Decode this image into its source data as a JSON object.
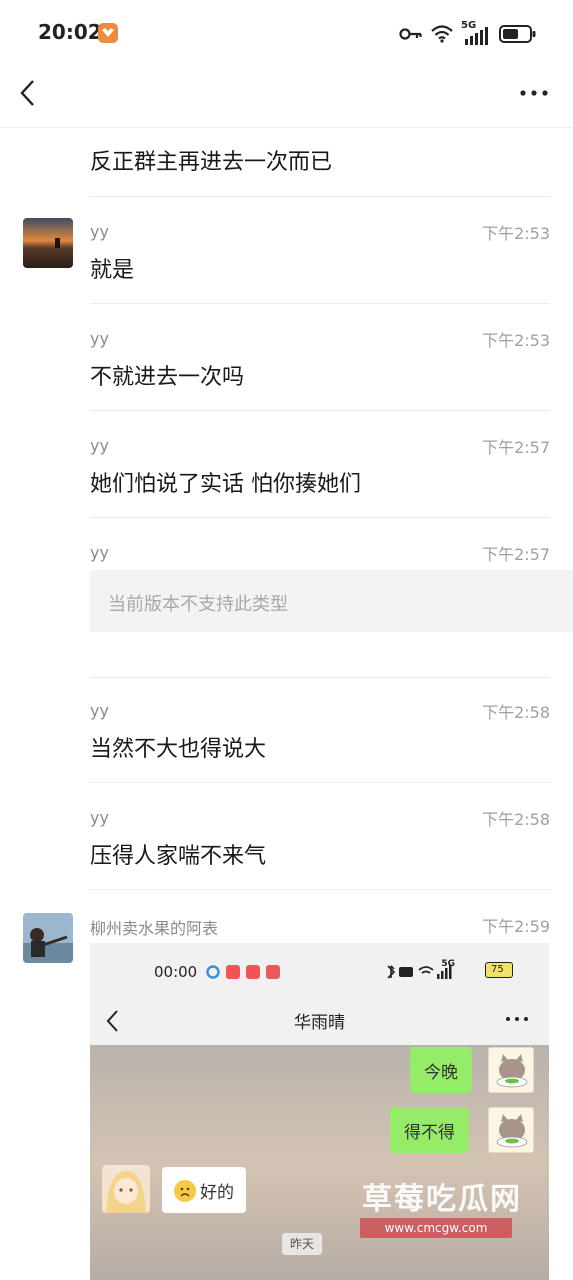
{
  "status_bar": {
    "time": "20:02",
    "network_label": "5G",
    "battery_icon": "battery-icon"
  },
  "nav": {
    "back_icon": "chevron-left-icon",
    "more_icon": "more-dots-icon"
  },
  "messages": [
    {
      "sender": "",
      "time": "",
      "text": "反正群主再进去一次而已"
    },
    {
      "sender": "yy",
      "time": "下午2:53",
      "text": "就是"
    },
    {
      "sender": "yy",
      "time": "下午2:53",
      "text": "不就进去一次吗"
    },
    {
      "sender": "yy",
      "time": "下午2:57",
      "text": "她们怕说了实话 怕你揍她们"
    },
    {
      "sender": "yy",
      "time": "下午2:57",
      "unsupported": "当前版本不支持此类型"
    },
    {
      "sender": "yy",
      "time": "下午2:58",
      "text": "当然不大也得说大"
    },
    {
      "sender": "yy",
      "time": "下午2:58",
      "text": "压得人家喘不来气"
    },
    {
      "sender": "柳州卖水果的阿表",
      "time": "下午2:59"
    }
  ],
  "screenshot_image": {
    "status_time": "00:00",
    "battery": "75",
    "signal": "5G",
    "chat_title": "华雨晴",
    "bubbles": [
      {
        "side": "right",
        "text": "今晚"
      },
      {
        "side": "right",
        "text": "得不得"
      },
      {
        "side": "left",
        "text": "好的"
      }
    ],
    "date_chip": "昨天"
  },
  "watermark": {
    "title": "草莓吃瓜网",
    "url": "www.cmcgw.com"
  },
  "colors": {
    "accent_green": "#95ec69",
    "divider": "#ececec",
    "secondary_text": "#8a8a8a"
  }
}
